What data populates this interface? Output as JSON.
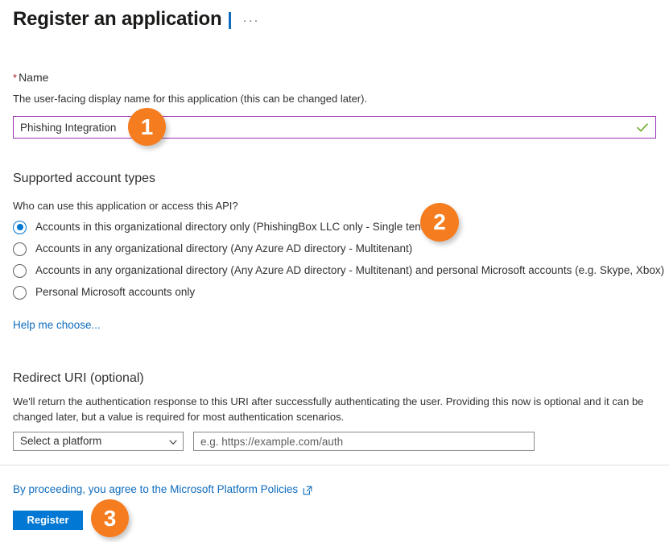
{
  "header": {
    "title": "Register an application",
    "more_label": "···"
  },
  "name_section": {
    "label": "Name",
    "required_marker": "*",
    "description": "The user-facing display name for this application (this can be changed later).",
    "value": "Phishing Integration",
    "placeholder": "",
    "valid_icon": "check-icon",
    "border_color": "#9b30b7",
    "check_color": "#6ba92a"
  },
  "account_types": {
    "heading": "Supported account types",
    "question": "Who can use this application or access this API?",
    "options": [
      {
        "label": "Accounts in this organizational directory only (PhishingBox LLC only - Single tenant)",
        "selected": true
      },
      {
        "label": "Accounts in any organizational directory (Any Azure AD directory - Multitenant)",
        "selected": false
      },
      {
        "label": "Accounts in any organizational directory (Any Azure AD directory - Multitenant) and personal Microsoft accounts (e.g. Skype, Xbox)",
        "selected": false
      },
      {
        "label": "Personal Microsoft accounts only",
        "selected": false
      }
    ],
    "help_link": "Help me choose...",
    "selected_color": "#0078d4"
  },
  "redirect_uri": {
    "heading": "Redirect URI (optional)",
    "description_line1": "We'll return the authentication response to this URI after successfully authenticating the user. Providing this now is optional and it can be",
    "description_line2": "changed later, but a value is required for most authentication scenarios.",
    "platform_value": "Select a platform",
    "uri_placeholder": "e.g. https://example.com/auth"
  },
  "footer": {
    "policy_text": "By proceeding, you agree to the Microsoft Platform Policies",
    "policy_icon": "external-link-icon",
    "register_label": "Register",
    "link_color": "#0f6cbd",
    "button_color": "#0078d4"
  },
  "annotations": {
    "badge_color": "#f57c1f",
    "steps": [
      {
        "number": "1",
        "target": "name-input"
      },
      {
        "number": "2",
        "target": "account-type-option-1"
      },
      {
        "number": "3",
        "target": "register-button"
      }
    ]
  }
}
